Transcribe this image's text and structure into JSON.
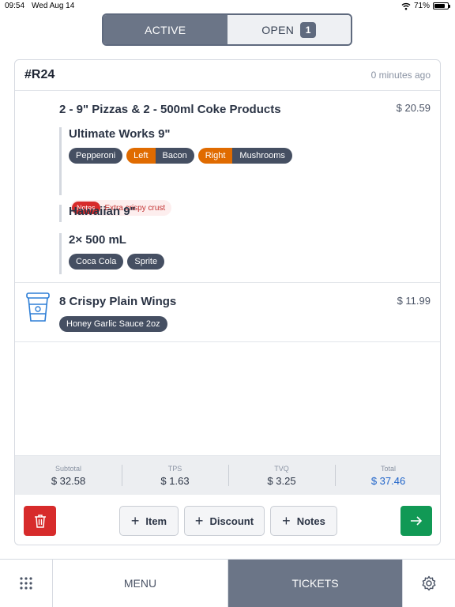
{
  "status_bar": {
    "time": "09:54",
    "date": "Wed Aug 14",
    "battery": "71%",
    "battery_level": 0.71
  },
  "segment": {
    "active_label": "ACTIVE",
    "open_label": "OPEN",
    "open_count": "1"
  },
  "order": {
    "id": "#R24",
    "age": "0 minutes ago",
    "items": [
      {
        "title": "2 - 9\" Pizzas & 2 - 500ml Coke Products",
        "price": "$ 20.59",
        "subs": [
          {
            "title": "Ultimate Works 9\"",
            "toppings": [
              "Pepperoni"
            ],
            "split": [
              {
                "side": "Left",
                "topping": "Bacon"
              },
              {
                "side": "Right",
                "topping": "Mushrooms"
              }
            ],
            "notes_label": "Notes",
            "notes": "Extra crispy crust"
          },
          {
            "title": "Hawaiian 9\""
          },
          {
            "title": "2× 500 mL",
            "drinks": [
              "Coca Cola",
              "Sprite"
            ]
          }
        ]
      },
      {
        "title": "8 Crispy Plain Wings",
        "price": "$ 11.99",
        "icon": "drink-cup-icon",
        "modifiers": [
          "Honey Garlic Sauce 2oz"
        ]
      }
    ]
  },
  "totals": {
    "subtotal_label": "Subtotal",
    "subtotal": "$ 32.58",
    "tps_label": "TPS",
    "tps": "$ 1.63",
    "tvq_label": "TVQ",
    "tvq": "$ 3.25",
    "total_label": "Total",
    "total": "$ 37.46"
  },
  "actions": {
    "item": "Item",
    "discount": "Discount",
    "notes": "Notes"
  },
  "tabbar": {
    "menu": "MENU",
    "tickets": "TICKETS"
  },
  "colors": {
    "accent_blue": "#1e63c9",
    "danger": "#d72b2b",
    "success": "#119955",
    "modifier_orange": "#e06b00",
    "chip": "#454f62"
  }
}
